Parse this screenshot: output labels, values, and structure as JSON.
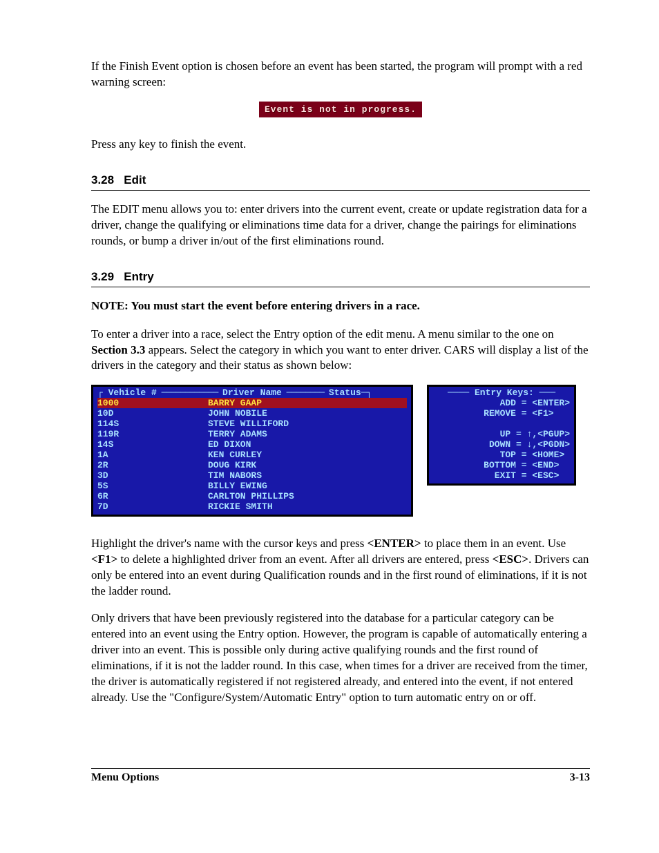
{
  "intro": {
    "p1": "If the Finish Event option is chosen before an event has been started, the program will prompt with a red warning screen:",
    "warning": "Event is not in progress.",
    "p2": "Press any key to finish the event."
  },
  "sec_edit": {
    "num": "3.28",
    "title": "Edit",
    "body": "The EDIT menu allows you to: enter drivers into the current event, create or update registration data for a driver, change the qualifying or eliminations time data for a driver, change the pairings for eliminations rounds, or bump a driver in/out of the first eliminations round."
  },
  "sec_entry": {
    "num": "3.29",
    "title": "Entry",
    "note": "NOTE: You must start the event before entering drivers in a race.",
    "p1a": "To enter a driver into a race, select the Entry option of the edit menu. A menu similar to the one on ",
    "p1bold": "Section 3.3",
    "p1b": " appears. Select the category in which you want to enter driver. CARS will display a list of the drivers in the category and their status as shown below:"
  },
  "driver_table": {
    "head_vehicle": "Vehicle #",
    "head_name": "Driver Name",
    "head_status": "Status",
    "rows": [
      {
        "veh": "1000",
        "name": "BARRY GAAP",
        "selected": true
      },
      {
        "veh": "10D",
        "name": "JOHN NOBILE"
      },
      {
        "veh": "114S",
        "name": "STEVE WILLIFORD"
      },
      {
        "veh": "119R",
        "name": "TERRY ADAMS"
      },
      {
        "veh": "14S",
        "name": "ED DIXON"
      },
      {
        "veh": "1A",
        "name": "KEN CURLEY"
      },
      {
        "veh": "2R",
        "name": "DOUG KIRK"
      },
      {
        "veh": "3D",
        "name": "TIM NABORS"
      },
      {
        "veh": "5S",
        "name": "BILLY EWING"
      },
      {
        "veh": "6R",
        "name": "CARLTON PHILLIPS"
      },
      {
        "veh": "7D",
        "name": "RICKIE SMITH"
      }
    ]
  },
  "keys_panel": {
    "title": "Entry Keys:",
    "lines": [
      "   ADD = <ENTER>",
      "REMOVE = <F1>   ",
      "",
      "    UP = ↑,<PGUP>",
      "  DOWN = ↓,<PGDN>",
      "   TOP = <HOME> ",
      "BOTTOM = <END>  ",
      "  EXIT = <ESC>  "
    ]
  },
  "after": {
    "p2_parts": [
      "Highlight the driver's name with the cursor keys and press ",
      "<ENTER>",
      " to place them in an event. Use ",
      "<F1>",
      " to delete a highlighted driver from an event. After all drivers are entered, press ",
      "<ESC>",
      ". Drivers can only be entered into an event during Qualification rounds and in the first round of eliminations, if it is not the ladder round."
    ],
    "p3": "Only drivers that have been previously registered into the database for a particular category can be entered into an event using the Entry option. However, the program is capable of automatically entering a driver into an event. This is possible only during active qualifying rounds and the first round of eliminations, if it is not the ladder round. In this case, when times for a driver are received from the timer, the driver is automatically registered if not registered already, and entered into the event, if not entered already. Use the \"Configure/System/Automatic Entry\" option to turn automatic entry on or off."
  },
  "footer": {
    "left": "Menu Options",
    "right": "3-13"
  }
}
